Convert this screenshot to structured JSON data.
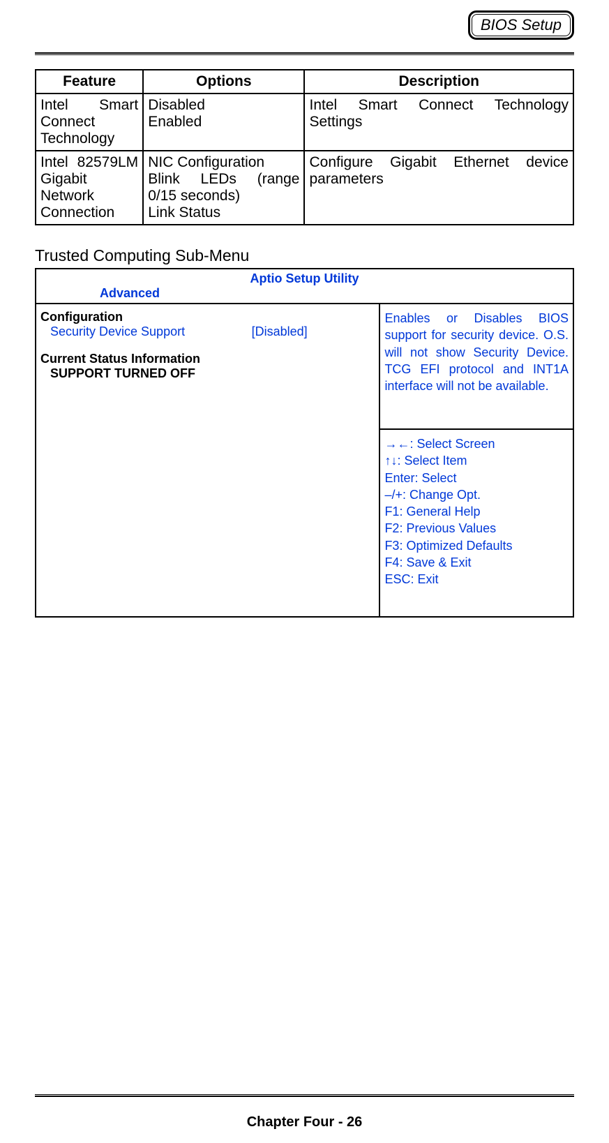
{
  "header": {
    "badge": "BIOS Setup"
  },
  "feature_table": {
    "headers": [
      "Feature",
      "Options",
      "Description"
    ],
    "rows": [
      {
        "feature": "Intel Smart Connect Technology",
        "options": "Disabled\nEnabled",
        "description": "Intel Smart Connect Technology Settings"
      },
      {
        "feature": "Intel 82579LM Gigabit Network Connection",
        "options": "NIC Configuration\nBlink LEDs (range 0/15 seconds)\nLink Status",
        "description": "Configure Gigabit Ethernet device parameters"
      }
    ]
  },
  "section_title": "Trusted Computing Sub-Menu",
  "bios": {
    "utility_title": "Aptio Setup Utility",
    "tab": "Advanced",
    "config_heading": "Configuration",
    "security_label": "Security Device Support",
    "security_value": "[Disabled]",
    "status_heading": "Current Status Information",
    "status_line": "SUPPORT TURNED OFF",
    "help": "Enables or Disables BIOS support for security device. O.S. will not show Security Device. TCG EFI protocol and INT1A interface will not be available.",
    "hints": [
      "→←: Select Screen",
      "↑↓: Select Item",
      "Enter: Select",
      "–/+: Change Opt.",
      "F1: General Help",
      "F2: Previous Values",
      "F3: Optimized Defaults",
      "F4: Save & Exit",
      "ESC: Exit"
    ]
  },
  "footer": "Chapter Four - 26"
}
